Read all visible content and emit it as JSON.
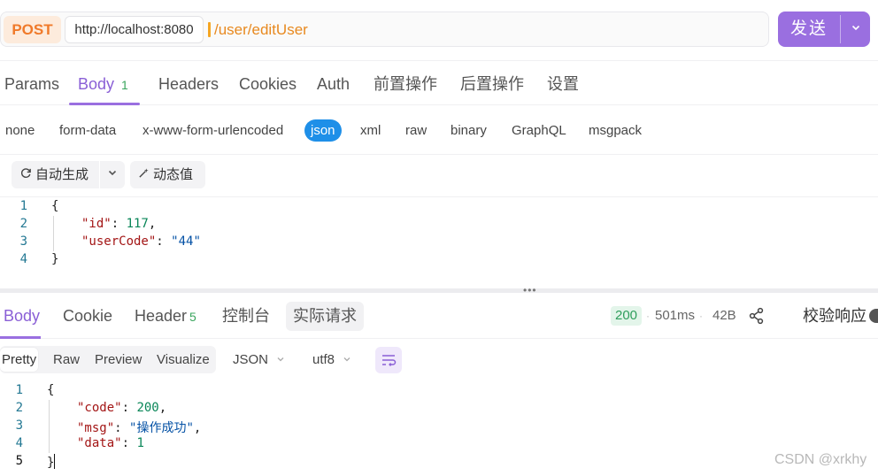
{
  "request": {
    "method": "POST",
    "host": "http://localhost:8080",
    "path": "/user/editUser",
    "send_label": "发送"
  },
  "request_tabs": [
    {
      "label": "Params"
    },
    {
      "label": "Body",
      "count": "1"
    },
    {
      "label": "Headers"
    },
    {
      "label": "Cookies"
    },
    {
      "label": "Auth"
    },
    {
      "label": "前置操作"
    },
    {
      "label": "后置操作"
    },
    {
      "label": "设置"
    }
  ],
  "body_types": [
    "none",
    "form-data",
    "x-www-form-urlencoded",
    "json",
    "xml",
    "raw",
    "binary",
    "GraphQL",
    "msgpack"
  ],
  "editor_toolbar": {
    "auto_generate": "自动生成",
    "dynamic_value": "动态值"
  },
  "request_body": {
    "line_numbers": [
      "1",
      "2",
      "3",
      "4"
    ],
    "open": "{",
    "id_key": "\"id\"",
    "id_value": "117",
    "usercode_key": "\"userCode\"",
    "usercode_value": "\"44\"",
    "close": "}"
  },
  "response_tabs": [
    {
      "label": "Body"
    },
    {
      "label": "Cookie"
    },
    {
      "label": "Header",
      "count": "5"
    },
    {
      "label": "控制台"
    },
    {
      "label": "实际请求"
    }
  ],
  "response_meta": {
    "status": "200",
    "time": "501ms",
    "size": "42B",
    "validate_label": "校验响应"
  },
  "response_view": {
    "modes": [
      "Pretty",
      "Raw",
      "Preview",
      "Visualize"
    ],
    "format": "JSON",
    "encoding": "utf8"
  },
  "response_body": {
    "line_numbers": [
      "1",
      "2",
      "3",
      "4",
      "5"
    ],
    "open": "{",
    "code_key": "\"code\"",
    "code_value": "200",
    "msg_key": "\"msg\"",
    "msg_value": "\"操作成功\"",
    "data_key": "\"data\"",
    "data_value": "1",
    "close": "}"
  },
  "watermark": "CSDN @xrkhy",
  "colors": {
    "accent": "#9a6fe0",
    "method": "#f07a2a",
    "json_active": "#1e8fe8",
    "status_ok": "#2f9e5c"
  },
  "icons": {
    "refresh": "refresh-icon",
    "magic": "magic-wand-icon",
    "share": "share-icon",
    "wrap": "wrap-lines-icon",
    "chevron": "chevron-down-icon",
    "grip": "drag-handle-icon"
  }
}
